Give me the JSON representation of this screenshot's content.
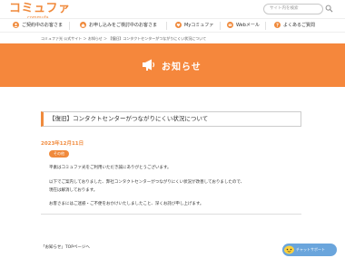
{
  "header": {
    "logo_main": "コミュファ",
    "logo_sub": "commufa",
    "search_placeholder": "サイト内を検索"
  },
  "nav": {
    "items": [
      {
        "label": "ご契約中のお客さま",
        "icon": "user-icon"
      },
      {
        "label": "お申し込みをご検討中のお客さま",
        "icon": "house-icon"
      },
      {
        "label": "Myコミュファ",
        "icon": "heart-icon"
      },
      {
        "label": "Webメール",
        "icon": "mail-icon"
      },
      {
        "label": "よくあるご質問",
        "icon": "question-icon"
      }
    ]
  },
  "breadcrumb": "コミュファ光 公式サイト ＞ お知らせ ＞ 【復旧】コンタクトセンターがつながりにくい状況について",
  "hero": {
    "title": "お知らせ",
    "icon": "megaphone-icon"
  },
  "article": {
    "title": "【復旧】コンタクトセンターがつながりにくい状況について",
    "date": "2023年12月11日",
    "tag": "その他",
    "paragraphs": [
      "平素はコミュファ光をご利用いただき誠にありがとうございます。",
      "以下でご案内しておりました、弊社コンタクトセンターがつながりにくい状況が改善しておりましたので、",
      "現在は解消しております。",
      "お客さまにはご迷惑・ご不便をおかけいたしましたこと、深くお詫び申し上げます。"
    ]
  },
  "footer": {
    "back_link": "「お知らせ」TOPページへ"
  },
  "chat": {
    "label": "チャットサポート",
    "icon": "chat-icon"
  },
  "colors": {
    "accent": "#f5873c",
    "chat": "#6aa5dc"
  }
}
